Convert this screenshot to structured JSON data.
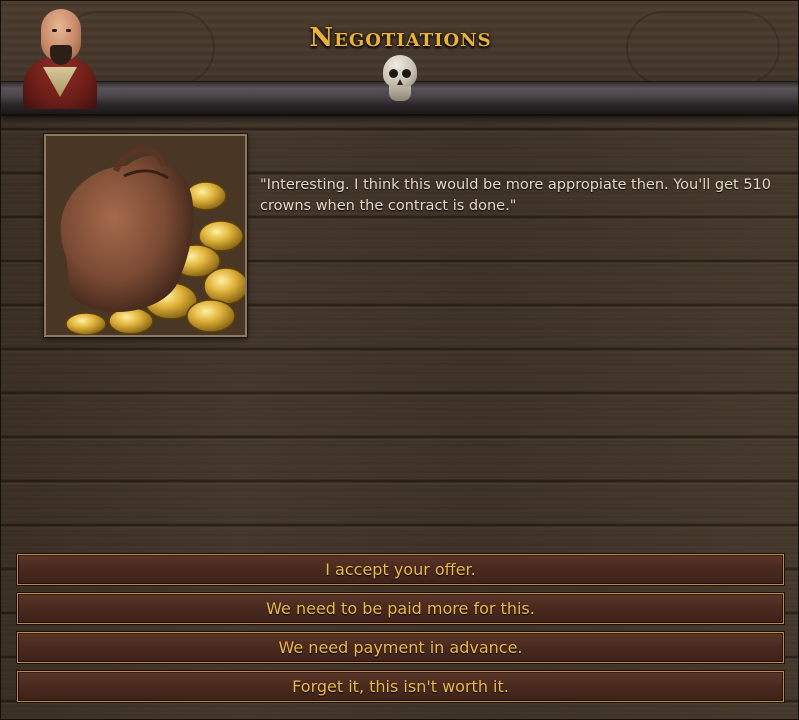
{
  "window": {
    "title": "Negotiations"
  },
  "dialogue": {
    "text": "\"Interesting. I think this would be more appropiate then. You'll get 510 crowns when the contract is done.\"",
    "image_name": "coin-purse"
  },
  "options": [
    {
      "label": "I accept your offer."
    },
    {
      "label": "We need to be paid more for this."
    },
    {
      "label": "We need payment in advance."
    },
    {
      "label": "Forget it, this isn't worth it."
    }
  ],
  "colors": {
    "title": "#e9b13a",
    "button_text": "#ecb84b",
    "button_border": "#c08a45",
    "dialogue_text": "#e4d9c4",
    "wood": "#3f3226"
  },
  "icons": {
    "portrait": "character-portrait-icon",
    "skull": "skull-icon"
  }
}
